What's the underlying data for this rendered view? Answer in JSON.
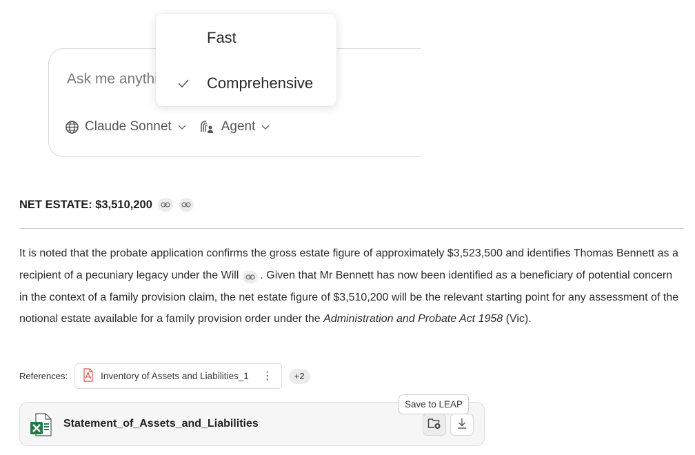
{
  "chat_input": {
    "placeholder": "Ask me anything",
    "model_label": "Claude Sonnet",
    "mode_label": "Agent"
  },
  "mode_dropdown": {
    "items": [
      {
        "label": "Fast",
        "selected": false
      },
      {
        "label": "Comprehensive",
        "selected": true
      }
    ]
  },
  "response": {
    "heading": "NET ESTATE: $3,510,200",
    "paragraph": {
      "part1": "It is noted that the probate application confirms the gross estate figure of approximately $3,523,500 and identifies Thomas Bennett as a recipient of a pecuniary legacy under the Will",
      "part2": ". Given that Mr Bennett has now been identified as a beneficiary of potential concern in the context of a family provision claim, the net estate figure of $3,510,200 will be the relevant starting point for any assessment of the notional estate available for a family provision order under the ",
      "act_title": "Administration and Probate Act 1958",
      "part3": " (Vic)."
    },
    "references": {
      "label": "References:",
      "first_file": "Inventory of Assets and Liabilities_1",
      "more_count": "+2"
    },
    "attachment": {
      "filename": "Statement_of_Assets_and_Liabilities",
      "tooltip": "Save to LEAP"
    }
  },
  "colors": {
    "excel_green": "#1f7a45",
    "pdf_red": "#d9534f",
    "border": "#dcdcdc",
    "chip_bg": "#ececec"
  },
  "icons": {
    "model": "globe-icon",
    "agent": "agent-icon",
    "chevron": "chevron-down-icon",
    "check": "check-icon",
    "link": "link-icon",
    "pdf": "pdf-file-icon",
    "excel": "excel-file-icon",
    "save": "folder-save-icon",
    "download": "download-icon"
  }
}
